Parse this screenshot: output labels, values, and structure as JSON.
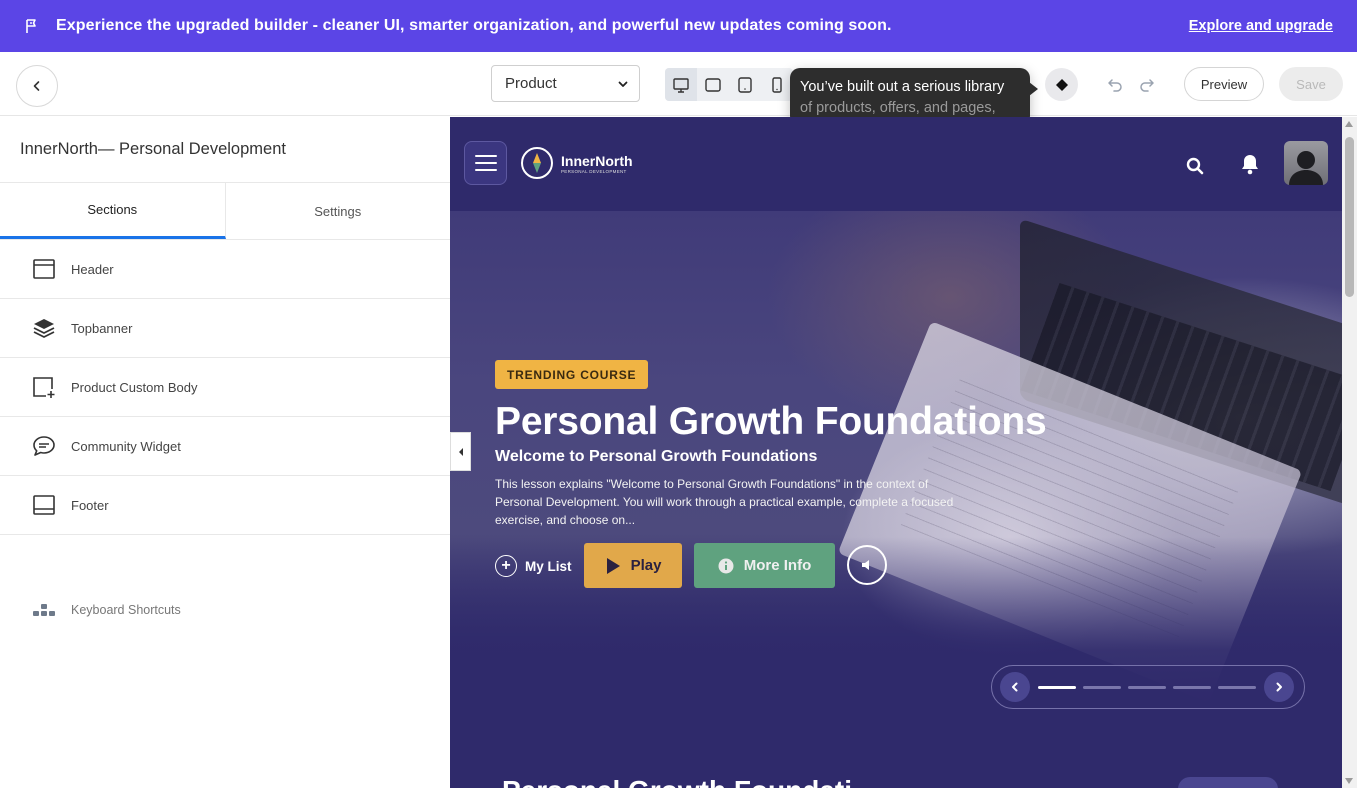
{
  "announcement": {
    "message": "Experience the upgraded builder - cleaner UI, smarter organization, and powerful new updates coming soon.",
    "link": "Explore and upgrade",
    "color": "#5b45e6"
  },
  "toolbar": {
    "page_select_value": "Product",
    "tooltip_line1": "You’ve built out a serious library",
    "tooltip_line2": "of products, offers, and pages,",
    "preview_label": "Preview",
    "save_label": "Save"
  },
  "sidebar": {
    "site_title": "InnerNorth— Personal Development",
    "tabs": [
      {
        "label": "Sections",
        "active": true
      },
      {
        "label": "Settings",
        "active": false
      }
    ],
    "sections": [
      {
        "label": "Header",
        "icon": "window-icon"
      },
      {
        "label": "Topbanner",
        "icon": "layers-icon"
      },
      {
        "label": "Product Custom Body",
        "icon": "add-box-icon"
      },
      {
        "label": "Community Widget",
        "icon": "chat-icon"
      },
      {
        "label": "Footer",
        "icon": "footer-icon"
      }
    ],
    "shortcuts_label": "Keyboard Shortcuts",
    "accent": "#1a73e8"
  },
  "preview": {
    "brand_name": "InnerNorth",
    "brand_tagline": "PERSONAL DEVELOPMENT",
    "badge": "TRENDING COURSE",
    "title": "Personal Growth Foundations",
    "subtitle": "Welcome to Personal Growth Foundations",
    "description": "This lesson explains \"Welcome to Personal Growth Foundations\" in the context of Personal Development. You will work through a practical example, complete a focused exercise, and choose on...",
    "my_list_label": "My List",
    "play_label": "Play",
    "more_info_label": "More Info",
    "slide_active": 1,
    "slide_count": 5,
    "section_title_cut": "Personal Growth Foundati",
    "colors": {
      "nav_bg": "#2f2a6b",
      "badge": "#f0b444",
      "play": "#e1a84a",
      "more_info": "#5fa27f"
    }
  }
}
